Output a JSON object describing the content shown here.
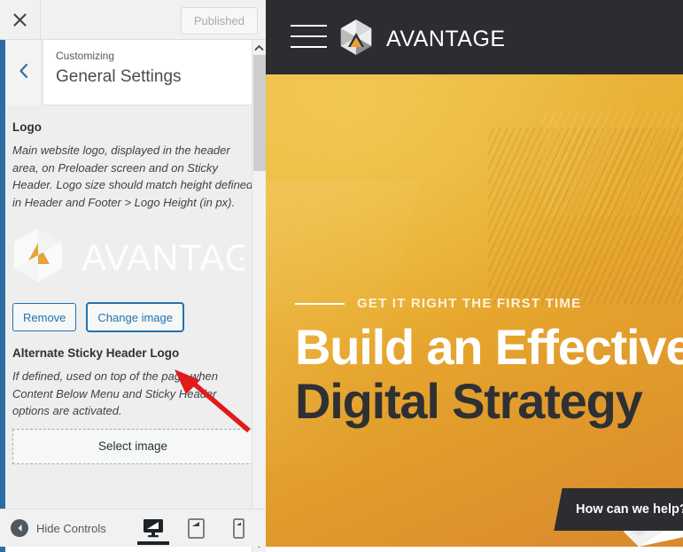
{
  "customizer": {
    "close_icon": "close-icon",
    "publish_label": "Published",
    "back_icon": "chevron-left-icon",
    "eyebrow": "Customizing",
    "title": "General Settings",
    "accent_color": "#2b6ca3",
    "sections": {
      "logo": {
        "label": "Logo",
        "description": "Main website logo, displayed in the header area, on Preloader screen and on Sticky Header. Logo size should match height defined in Header and Footer > Logo Height (in px).",
        "preview_alt": "AVANTAGE",
        "remove_label": "Remove",
        "change_label": "Change image"
      },
      "alternate_logo": {
        "label": "Alternate Sticky Header Logo",
        "description": "If defined, used on top of the page when Content Below Menu and Sticky Header options are activated.",
        "select_label": "Select image"
      }
    },
    "scrollbar": {
      "up_icon": "chevron-up-icon",
      "down_icon": "chevron-down-icon"
    },
    "footer": {
      "hide_controls_label": "Hide Controls",
      "hide_icon": "collapse-left-icon",
      "devices": [
        {
          "name": "desktop",
          "icon": "desktop-icon",
          "active": true
        },
        {
          "name": "tablet",
          "icon": "tablet-icon",
          "active": false
        },
        {
          "name": "mobile",
          "icon": "mobile-icon",
          "active": false
        }
      ]
    }
  },
  "preview": {
    "header": {
      "menu_icon": "hamburger-menu-icon",
      "logo_icon": "avantage-hexagon-logo-icon",
      "brand_name": "AVANTAGE",
      "background_color": "#2b2d30"
    },
    "hero": {
      "kicker": "GET IT RIGHT THE FIRST TIME",
      "headline_line1": "Build an Effective",
      "headline_line2": "Digital Strategy",
      "cta_label": "How can we help?",
      "accent_color": "#e8ab2e",
      "headline_line1_color": "#ffffff",
      "headline_line2_color": "#2f3033",
      "cta_background": "#2b2d30"
    }
  },
  "annotation": {
    "arrow": "red-pointer-arrow",
    "color": "#e01b1b"
  }
}
